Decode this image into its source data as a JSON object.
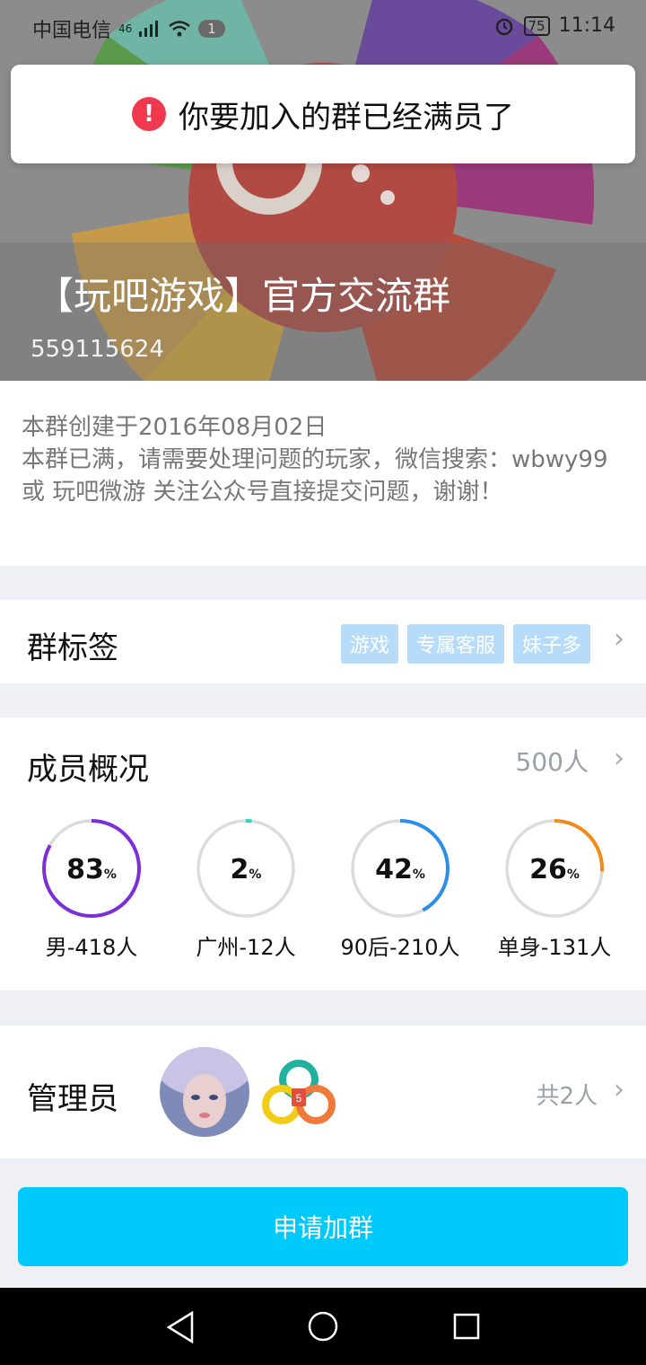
{
  "status_bar": {
    "carrier": "中国电信",
    "network": "46",
    "notification_count": "1",
    "battery": "75",
    "time": "11:14"
  },
  "toast": {
    "icon": "error-icon",
    "message": "你要加入的群已经满员了"
  },
  "group": {
    "title": "【玩吧游戏】官方交流群",
    "id": "559115624",
    "description": "本群创建于2016年08月02日\n本群已满，请需要处理问题的玩家，微信搜索：wbwy99 或 玩吧微游 关注公众号直接提交问题，谢谢！"
  },
  "tags_section": {
    "label": "群标签",
    "tags": [
      "游戏",
      "专属客服",
      "妹子多"
    ]
  },
  "members_section": {
    "label": "成员概况",
    "count": "500人",
    "stats": [
      {
        "percent": "83",
        "unit": "%",
        "value": 0.83,
        "label": "男-418人",
        "color": "#7b2fd6"
      },
      {
        "percent": "2",
        "unit": "%",
        "value": 0.02,
        "label": "广州-12人",
        "color": "#2fd6b8"
      },
      {
        "percent": "42",
        "unit": "%",
        "value": 0.42,
        "label": "90后-210人",
        "color": "#2b8fea"
      },
      {
        "percent": "26",
        "unit": "%",
        "value": 0.26,
        "label": "单身-131人",
        "color": "#f08a1c"
      }
    ]
  },
  "admins_section": {
    "label": "管理员",
    "count": "共2人"
  },
  "join_button": "申请加群",
  "colors": {
    "accent": "#00cafc",
    "tag_bg": "#b7dcf9",
    "toast_error": "#f0384e"
  }
}
